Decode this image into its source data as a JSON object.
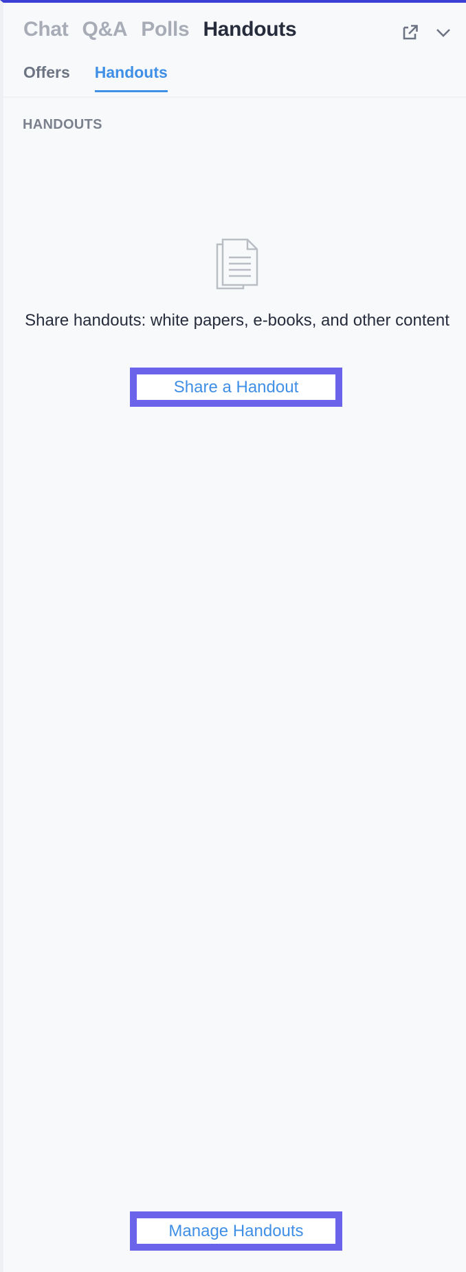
{
  "header": {
    "tabs": [
      {
        "label": "Chat",
        "active": false
      },
      {
        "label": "Q&A",
        "active": false
      },
      {
        "label": "Polls",
        "active": false
      },
      {
        "label": "Handouts",
        "active": true
      }
    ],
    "icons": [
      "popout-icon",
      "chevron-down-icon"
    ]
  },
  "subtabs": [
    {
      "label": "Offers",
      "active": false
    },
    {
      "label": "Handouts",
      "active": true
    }
  ],
  "section": {
    "title": "HANDOUTS"
  },
  "empty_state": {
    "icon": "document-icon",
    "message": "Share handouts: white papers, e-books, and other content",
    "button_label": "Share a Handout"
  },
  "footer": {
    "manage_label": "Manage Handouts"
  },
  "colors": {
    "accent": "#3f8fe6",
    "highlight_border": "#6b63ea",
    "top_border": "#3b3fd6",
    "text_dark": "#262c3b",
    "text_muted": "#a7acb6"
  }
}
